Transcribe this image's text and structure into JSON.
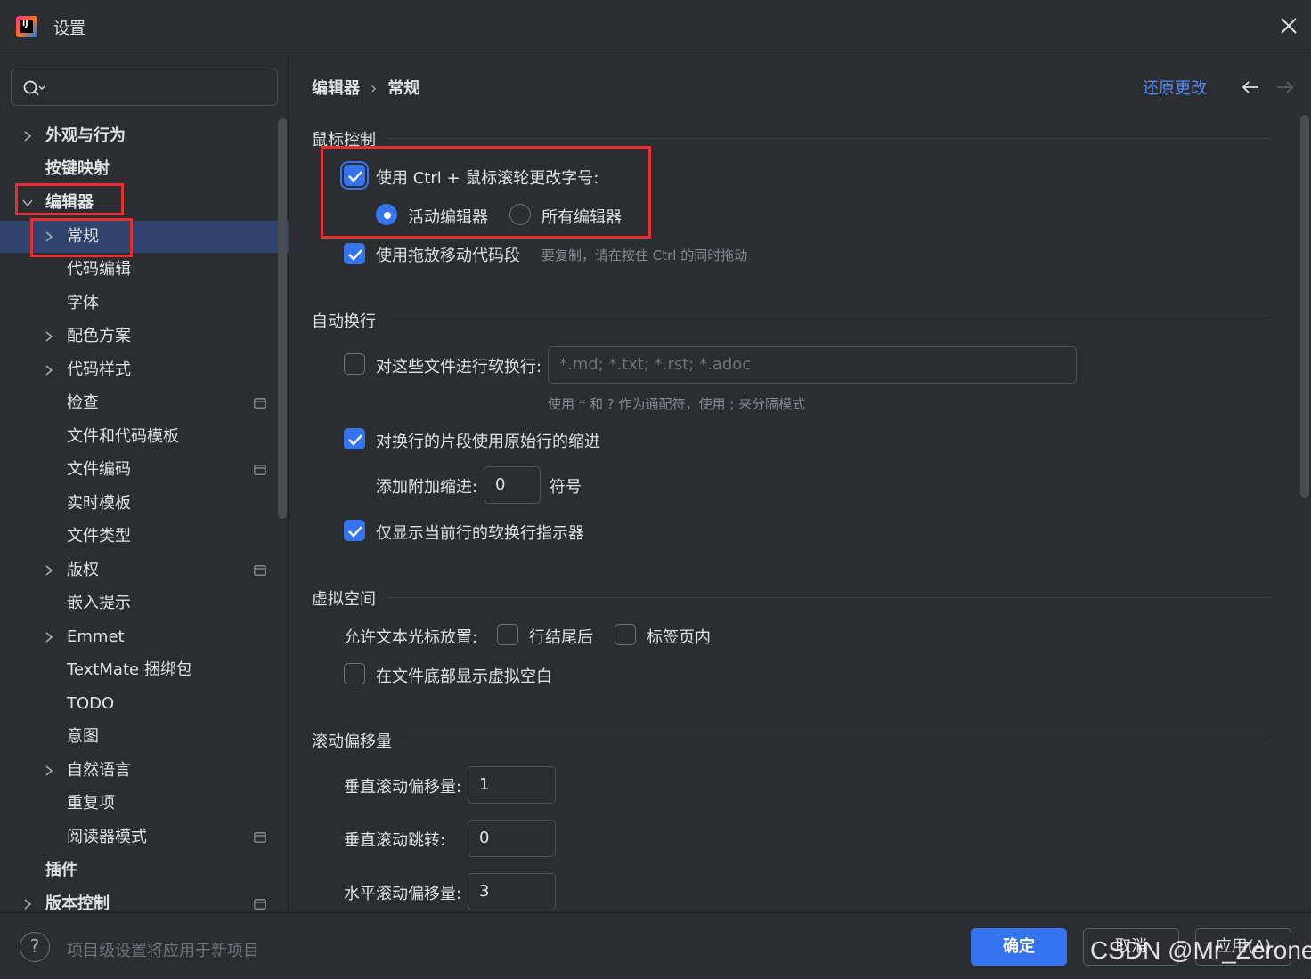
{
  "window": {
    "title": "设置"
  },
  "sidebar": {
    "search": {
      "placeholder": ""
    },
    "items": [
      {
        "label": "外观与行为"
      },
      {
        "label": "按键映射"
      },
      {
        "label": "编辑器"
      },
      {
        "label": "常规"
      },
      {
        "label": "代码编辑"
      },
      {
        "label": "字体"
      },
      {
        "label": "配色方案"
      },
      {
        "label": "代码样式"
      },
      {
        "label": "检查"
      },
      {
        "label": "文件和代码模板"
      },
      {
        "label": "文件编码"
      },
      {
        "label": "实时模板"
      },
      {
        "label": "文件类型"
      },
      {
        "label": "版权"
      },
      {
        "label": "嵌入提示"
      },
      {
        "label": "Emmet"
      },
      {
        "label": "TextMate 捆绑包"
      },
      {
        "label": "TODO"
      },
      {
        "label": "意图"
      },
      {
        "label": "自然语言"
      },
      {
        "label": "重复项"
      },
      {
        "label": "阅读器模式"
      },
      {
        "label": "插件"
      },
      {
        "label": "版本控制"
      }
    ]
  },
  "header": {
    "breadcrumb": [
      "编辑器",
      "常规"
    ],
    "separator": "›",
    "reset_label": "还原更改"
  },
  "sections": {
    "mouse": {
      "title": "鼠标控制",
      "ctrl_wheel": "使用 Ctrl + 鼠标滚轮更改字号:",
      "radio_active": "活动编辑器",
      "radio_all": "所有编辑器",
      "drag_drop": "使用拖放移动代码段",
      "drag_hint": "要复制，请在按住 Ctrl 的同时拖动"
    },
    "wrap": {
      "title": "自动换行",
      "soft_wrap_label": "对这些文件进行软换行:",
      "soft_wrap_placeholder": "*.md; *.txt; *.rst; *.adoc",
      "soft_wrap_hint": "使用 * 和 ? 作为通配符，使用 ; 来分隔模式",
      "indent_original": "对换行的片段使用原始行的缩进",
      "extra_indent_label": "添加附加缩进:",
      "extra_indent_value": "0",
      "extra_indent_unit": "符号",
      "show_indicator": "仅显示当前行的软换行指示器"
    },
    "virtual": {
      "title": "虚拟空间",
      "allow_caret": "允许文本光标放置:",
      "after_eol": "行结尾后",
      "inside_tabs": "标签页内",
      "virtual_space_bottom": "在文件底部显示虚拟空白"
    },
    "scroll": {
      "title": "滚动偏移量",
      "vertical_offset_label": "垂直滚动偏移量:",
      "vertical_offset_value": "1",
      "vertical_jump_label": "垂直滚动跳转:",
      "vertical_jump_value": "0",
      "horizontal_offset_label": "水平滚动偏移量:",
      "horizontal_offset_value": "3"
    }
  },
  "footer": {
    "note": "项目级设置将应用于新项目",
    "ok_label": "确定",
    "cancel_label": "取消",
    "apply_label": "应用(A)",
    "help": "?"
  },
  "watermark": "CSDN @Mr_Zerone",
  "colors": {
    "accent": "#3574f0",
    "link": "#548af7",
    "annotation": "#e62e2e",
    "selection": "#2e436e"
  }
}
